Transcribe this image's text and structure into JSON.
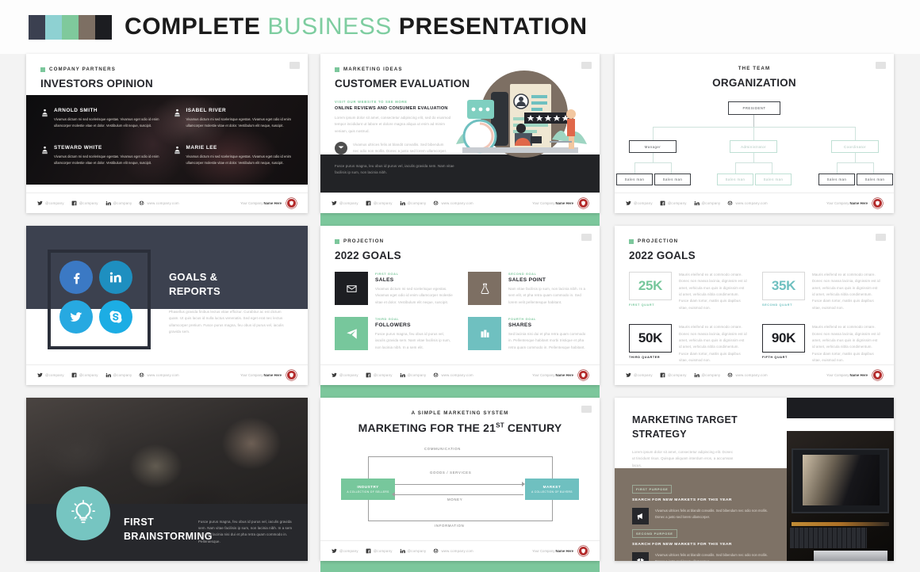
{
  "header": {
    "title_part1": "COMPLETE ",
    "title_accent": "BUSINESS",
    "title_part2": " PRESENTATION",
    "swatches": [
      "#3b4050",
      "#8ed1d2",
      "#7fc99c",
      "#7d6f63",
      "#1c1d21"
    ]
  },
  "common": {
    "social": [
      {
        "icon": "twitter-icon",
        "text": "@company"
      },
      {
        "icon": "facebook-icon",
        "text": "@company"
      },
      {
        "icon": "linkedin-icon",
        "text": "@company"
      },
      {
        "icon": "globe-icon",
        "text": "www.company.com"
      }
    ],
    "footer_left": "Your Company ",
    "footer_brand": "Name Here",
    "lorem_short": "Vivamus dictum mi sed scelerisque egestas. Vivamus eget odio id enim ullamcorper molestie vitae et dolor. Vestibulum elit neque, suscipit.",
    "page_badge": "page-number-badge"
  },
  "slides": {
    "investors": {
      "eyebrow": "COMPANY PARTNERS",
      "title": "INVESTORS OPINION",
      "people": [
        {
          "name": "ARNOLD SMITH",
          "body": "Vivamus dictum mi sed scelerisque egestas. Vivamus eget odio id enim ullamcorper molestie vitae et dolor. Vestibulum elit neque, suscipit."
        },
        {
          "name": "ISABEL RIVER",
          "body": "Vivamus dictum mi sed scelerisque egestas. Vivamus eget odio id enim ullamcorper molestie vitae et dolor. Vestibulum elit neque, suscipit."
        },
        {
          "name": "STEWARD WHITE",
          "body": "Vivamus dictum mi sed scelerisque egestas. Vivamus eget odio id enim ullamcorper molestie vitae et dolor. Vestibulum elit neque, suscipit."
        },
        {
          "name": "MARIE LEE",
          "body": "Vivamus dictum mi sed scelerisque egestas. Vivamus eget odio id enim ullamcorper molestie vitae et dolor. Vestibulum elit neque, suscipit."
        }
      ]
    },
    "customer": {
      "eyebrow": "MARKETING IDEAS",
      "title": "CUSTOMER EVALUATION",
      "kicker": "VISIT OUR WEBSITE TO SEE MORE",
      "subtitle": "ONLINE REVIEWS AND CONSUMER EVALUATION",
      "body": "Lorem ipsum dolor sit amet, consectetur adipiscing elit, sed do eiusmod tempor incididunt ut labore et dolore magna aliqua ut enim ad minim veniam, quis nostrud.",
      "mail_body": "Vivamus ultrices felis at blandit convallis. Sed bibendum nec odio non mollis. Donec a justo sed lorem ullamcorper.",
      "dark_body": "Fusce purus magna, leu obus id purus vel, iaculis gravida sem. Nam vitae facilisis ip sum, non lacinia nibh."
    },
    "organization": {
      "eyebrow": "THE TEAM",
      "title": "ORGANIZATION",
      "root": "PRESIDENT",
      "level2": [
        "Manager",
        "Administrator",
        "Coordinator"
      ],
      "level3": [
        "Sales man",
        "Sales man",
        "Sales man",
        "Sales man",
        "Sales man",
        "Sales man"
      ]
    },
    "goals_reports": {
      "title_line1": "GOALS &",
      "title_line2": "REPORTS",
      "body": "Phasellus gravida finibus lectus vitae efficitur. Curabitur ac est dictum quam. Ut quis lacus id nulla luctus venenatis. Sed eget erat nec lectus ullamcorper pretium. Fusce purus magna, feu obus id purus vel, iaculis gravida sem.",
      "socials": [
        {
          "name": "facebook-circle-icon",
          "color": "#3b79c4"
        },
        {
          "name": "linkedin-circle-icon",
          "color": "#1e8fc0"
        },
        {
          "name": "twitter-circle-icon",
          "color": "#27a9e1"
        },
        {
          "name": "skype-circle-icon",
          "color": "#1cade4"
        }
      ]
    },
    "goals_cards": {
      "eyebrow": "PROJECTION",
      "title": "2022 GOALS",
      "cards": [
        {
          "kicker": "FIRST GOAL",
          "title": "SALES",
          "icon": "envelope-icon",
          "color": "#1d1e22",
          "body": "Vivamus dictum mi sed scelerisque egestas. Vivamus eget odio id enim ullamcorper molestie vitae et dolor. Vestibulum elit neque, suscipit."
        },
        {
          "kicker": "SECOND GOAL",
          "title": "SALES POINT",
          "icon": "flask-icon",
          "color": "#7d6f63",
          "body": "Nam vitae facilisis ip sum, non lacinia nibh. In a sem elit, et pha retra quam commodo in. Sed lorem velit pellentesque habitant."
        },
        {
          "kicker": "THIRD GOAL",
          "title": "FOLLOWERS",
          "icon": "paper-plane-icon",
          "color": "#77c79c",
          "body": "Fusce purus magna, feu obus id purus vel, iaculis gravida sem. Nam vitae facilisis ip sum, non lacinia nibh. In a sem elit."
        },
        {
          "kicker": "FOURTH GOAL",
          "title": "SHARES",
          "icon": "share-icon",
          "color": "#6fc0c0",
          "body": "Sed lacinia nisi dui et pha retra quam commodo in. Pellentesque habitant morbi tristique et pha retra quam commodo in. Pellentesque habitant."
        }
      ]
    },
    "goals_numbers": {
      "eyebrow": "PROJECTION",
      "title": "2022 GOALS",
      "items": [
        {
          "value": "25K",
          "label": "FIRST QUART",
          "color": "#77c79c",
          "body": "Mauris eleifend ex at commodo ornare. Donec non massa lacinia, dignissim est id amet, vehicula mus quis in  dignissim est id amet, vehicula nibla condimentum. Fusce diam tortor, mattis quis dapibus vitae, euismod non."
        },
        {
          "value": "35K",
          "label": "SECOND QUART",
          "color": "#6fc0c0",
          "body": "Mauris eleifend ex at commodo ornare. Donec non massa lacinia, dignissim est id amet, vehicula mus quis in  dignissim est id amet, vehicula nibla condimentum. Fusce diam tortor, mattis quis dapibus vitae, euismod non."
        },
        {
          "value": "50K",
          "label": "THIRD QUARTER",
          "color": "#1d1e22",
          "body": "Mauris eleifend ex at commodo ornare. Donec non massa lacinia, dignissim est id amet, vehicula mus quis in  dignissim est id amet, vehicula nibla condimentum. Fusce diam tortor, mattis quis dapibus vitae, euismod non."
        },
        {
          "value": "90K",
          "label": "FIFTH QUART",
          "color": "#1d1e22",
          "body": "Mauris eleifend ex at commodo ornare. Donec non massa lacinia, dignissim est id amet, vehicula mus quis in  dignissim est id amet, vehicula nibla condimentum. Fusce diam tortor, mattis quis dapibus vitae, euismod non."
        }
      ]
    },
    "brainstorming": {
      "title_line1": "FIRST",
      "title_line2": "BRAINSTORMING",
      "icon": "lightbulb-icon",
      "body": "Fusce purus magna, feu obus id purus vel, iaculis gravida sem. Nam vitae facilisis ip sum, non lacinia nibh. In a sem elit. Sed lacinia nisi dui et pha retra quam commodo in. Pellentesque."
    },
    "marketing_system": {
      "eyebrow": "A SIMPLE MARKETING SYSTEM",
      "title_a": "MARKETING FOR THE 21",
      "title_sup": "ST",
      "title_b": " CENTURY",
      "left_box_title": "INDUSTRY",
      "left_box_sub": "A COLLECTION OF SELLERS",
      "right_box_title": "MARKET",
      "right_box_sub": "A COLLECTION OF BUYERS",
      "label_top": "COMMUNICATION",
      "label_goods": "GOODS / SERVICES",
      "label_money": "MONEY",
      "label_bottom": "INFORMATION"
    },
    "target_strategy": {
      "title_line1": "MARKETING TARGET",
      "title_line2": "STRATEGY",
      "body": "Lorem ipsum dolor sit amet, consectetur adipiscing elit. Donec ut tincidunt risus. Quisque aliquam interdum eros, a accumsan lacus.",
      "purposes": [
        {
          "kicker": "FIRST PURPOSE",
          "title": "SEARCH FOR NEW MARKETS FOR THIS YEAR",
          "icon": "megaphone-icon",
          "body": "Vivamus ultrices felis at blandit convallis. Sed bibendum nec odio non mollis. Donec a justo sed lorem ullamcorper."
        },
        {
          "kicker": "SECOND PURPOSE",
          "title": "SEARCH FOR NEW MARKETS FOR THIS YEAR",
          "icon": "gift-icon",
          "body": "Vivamus ultrices felis at blandit convallis. Sed bibendum nec odio non mollis. Donec a justo sed lorem ullamcorper."
        }
      ]
    }
  }
}
